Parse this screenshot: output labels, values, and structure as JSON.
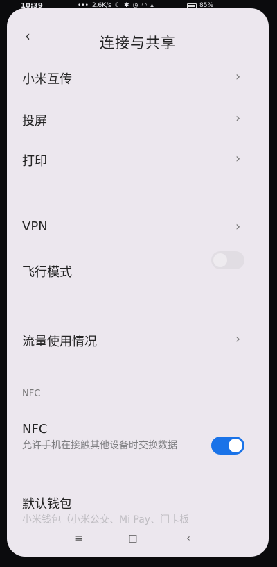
{
  "status": {
    "time": "10:39",
    "network_speed": "2.6K/s",
    "battery": "85%"
  },
  "header": {
    "title": "连接与共享"
  },
  "rows": {
    "mi_share": "小米互传",
    "cast": "投屏",
    "print": "打印",
    "vpn": "VPN",
    "airplane": "飞行模式",
    "data_usage": "流量使用情况"
  },
  "airplane_toggle": {
    "state": "off"
  },
  "nfc": {
    "section_label": "NFC",
    "title": "NFC",
    "description": "允许手机在接触其他设备时交换数据",
    "toggle_state": "on"
  },
  "wallet": {
    "title": "默认钱包",
    "subtitle_faded": "小米钱包（小米公交、Mi Pay、门卡板"
  },
  "colors": {
    "accent": "#1a73e8",
    "background": "#ece7ee"
  },
  "icons": {
    "back": "back-arrow-icon",
    "chevron": "chevron-right-icon"
  }
}
